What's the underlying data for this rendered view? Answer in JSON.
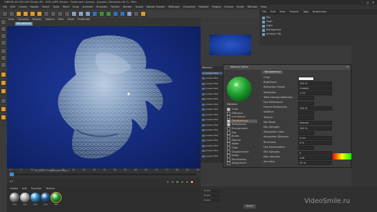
{
  "window": {
    "title": "CINEMA 4D R20.026 Studio (RC - R20) (NFR Version - Restricted License) - [Jurassic_Materials.c4d *] - Main",
    "controls": [
      "–",
      "□",
      "✕"
    ]
  },
  "menubar": [
    "File",
    "Edit",
    "Create",
    "Modes",
    "Select",
    "Tools",
    "Mesh",
    "Snap",
    "Animate",
    "Simulate",
    "Tracker",
    "Render",
    "Sculpt",
    "Motion Tracker",
    "MoGraph",
    "Character",
    "Pipeline",
    "Plugins",
    "Octane",
    "Script",
    "Window",
    "Help"
  ],
  "viewport": {
    "menu": [
      "View",
      "Cameras",
      "Display",
      "Options",
      "Filter",
      "Panel",
      "ProRender"
    ],
    "label": "Perspective"
  },
  "timeline": {
    "ticks": [
      "0",
      "5",
      "10",
      "15",
      "20",
      "25",
      "30",
      "35",
      "40",
      "45",
      "50",
      "55",
      "60",
      "65",
      "70",
      "75",
      "80",
      "85",
      "90"
    ],
    "status": "00:00:47 Progressive Pass 1",
    "frame": "0 F"
  },
  "material_manager": {
    "menu": [
      "Create",
      "Edit",
      "Function",
      "Texture"
    ],
    "materials": [
      {
        "name": "Mat",
        "color": "#8e8e8e"
      },
      {
        "name": "Mat",
        "color": "#b0b0b0"
      },
      {
        "name": "Mat",
        "color": "#2a8ad0"
      },
      {
        "name": "Mat",
        "color": "#1a5a9a"
      },
      {
        "name": "Mat",
        "color": "#1ea030"
      }
    ]
  },
  "objects_panel": {
    "tabs": [
      "File",
      "Edit",
      "View",
      "Objects",
      "Tags",
      "Bookmarks"
    ],
    "rows": [
      "Sky",
      "Floor",
      "Light",
      "Background",
      "Jurassic Obj"
    ]
  },
  "material_list": {
    "label": "Material",
    "items": [
      "Jurassic Mat",
      "Jurassic Mat",
      "Jurassic Mat",
      "Jurassic Mat",
      "Jurassic Mat",
      "Jurassic Mat",
      "Jurassic Mat",
      "Jurassic Mat",
      "Jurassic Mat",
      "Jurassic Mat",
      "Jurassic Mat",
      "Jurassic Mat",
      "Jurassic Mat",
      "Jurassic Mat",
      "Jurassic Mat",
      "Jurassic Mat",
      "Jurassic Mat"
    ]
  },
  "material_editor": {
    "title": "Material Editor",
    "material_name": "Material",
    "channels": [
      {
        "name": "Color",
        "on": true
      },
      {
        "name": "Diffusion",
        "on": false
      },
      {
        "name": "Luminance",
        "on": false
      },
      {
        "name": "Transparency",
        "on": true,
        "active": true
      },
      {
        "name": "Reflectance",
        "on": true
      },
      {
        "name": "Environment",
        "on": false
      },
      {
        "name": "Fog",
        "on": false
      },
      {
        "name": "Bump",
        "on": false
      },
      {
        "name": "Normal",
        "on": false
      },
      {
        "name": "Alpha",
        "on": false
      },
      {
        "name": "Glow",
        "on": false
      },
      {
        "name": "Displacement",
        "on": false
      },
      {
        "name": "Editor",
        "on": false
      },
      {
        "name": "Illumination",
        "on": false
      },
      {
        "name": "Assignment",
        "on": false
      }
    ],
    "section": "Transparency",
    "params": [
      {
        "label": "Color",
        "value": ""
      },
      {
        "label": "Brightness",
        "value": "100 %"
      },
      {
        "label": "Refraction Preset",
        "value": "Custom"
      },
      {
        "label": "Refraction",
        "value": "1.33"
      },
      {
        "label": "Total Internal Reflection",
        "value": ""
      },
      {
        "label": "Exit Reflections",
        "value": ""
      },
      {
        "label": "Fresnel Reflectivity",
        "value": "100 %"
      },
      {
        "label": "Additive",
        "value": ""
      },
      {
        "label": "Texture",
        "value": ""
      },
      {
        "label": "Mix Mode",
        "value": "Normal"
      },
      {
        "label": "Mix Strength",
        "value": "100 %"
      },
      {
        "label": "Absorption Color",
        "value": ""
      },
      {
        "label": "Absorption Distance",
        "value": "0 cm"
      },
      {
        "label": "Blurriness",
        "value": "0 %"
      },
      {
        "label": "Use Interpolation",
        "value": ""
      },
      {
        "label": "Min Samples",
        "value": "5"
      },
      {
        "label": "Max Samples",
        "value": "128"
      },
      {
        "label": "Accuracy",
        "value": "50 %"
      }
    ]
  },
  "bottom_right": {
    "buttons": [
      "Apply"
    ],
    "coords": [
      "0 cm",
      "0 cm",
      "0 cm"
    ]
  },
  "watermark": "VideoSmile.ru",
  "colors": {
    "accent_orange": "#e09a2a",
    "viewport_blue": "#1a3390",
    "sphere_green": "#1ea030"
  }
}
